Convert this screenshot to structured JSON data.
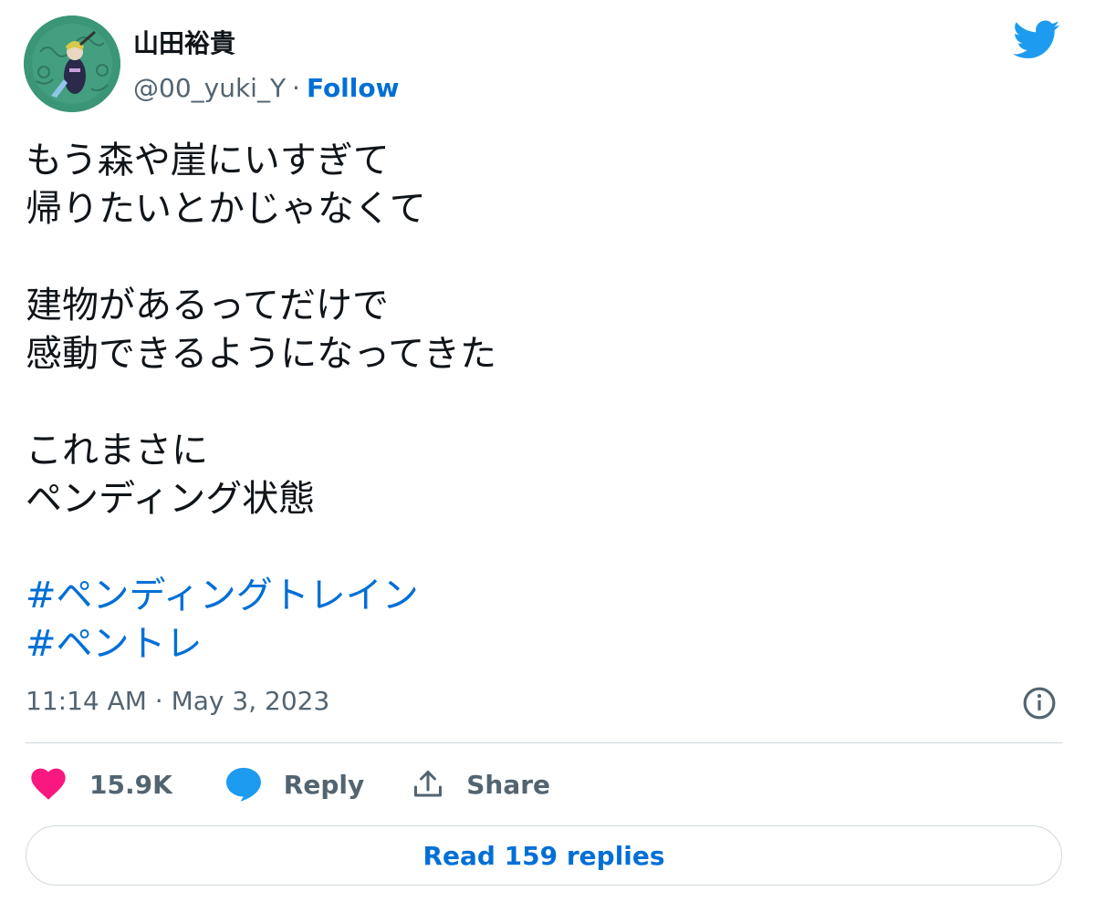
{
  "user": {
    "name": "山田裕貴",
    "handle": "@00_yuki_Y",
    "separator": "·",
    "follow_label": "Follow"
  },
  "tweet": {
    "lines": [
      "もう森や崖にいすぎて",
      "帰りたいとかじゃなくて",
      "",
      "建物があるってだけで",
      "感動できるようになってきた",
      "",
      "これまさに",
      "ペンディング状態",
      ""
    ],
    "hashtags": [
      "#ペンディングトレイン",
      "#ペントレ"
    ],
    "timestamp": "11:14 AM · May 3, 2023"
  },
  "actions": {
    "likes_count": "15.9K",
    "reply_label": "Reply",
    "share_label": "Share"
  },
  "read_replies_label": "Read 159 replies",
  "colors": {
    "accent": "#006fd6",
    "twitter_blue": "#1d9bf0",
    "like_pink": "#f91880",
    "muted": "#536471",
    "border": "#cfd9de"
  },
  "icons": {
    "brand": "twitter-bird-icon",
    "info": "info-icon",
    "like": "heart-icon",
    "reply": "speech-bubble-icon",
    "share": "share-upload-icon"
  }
}
